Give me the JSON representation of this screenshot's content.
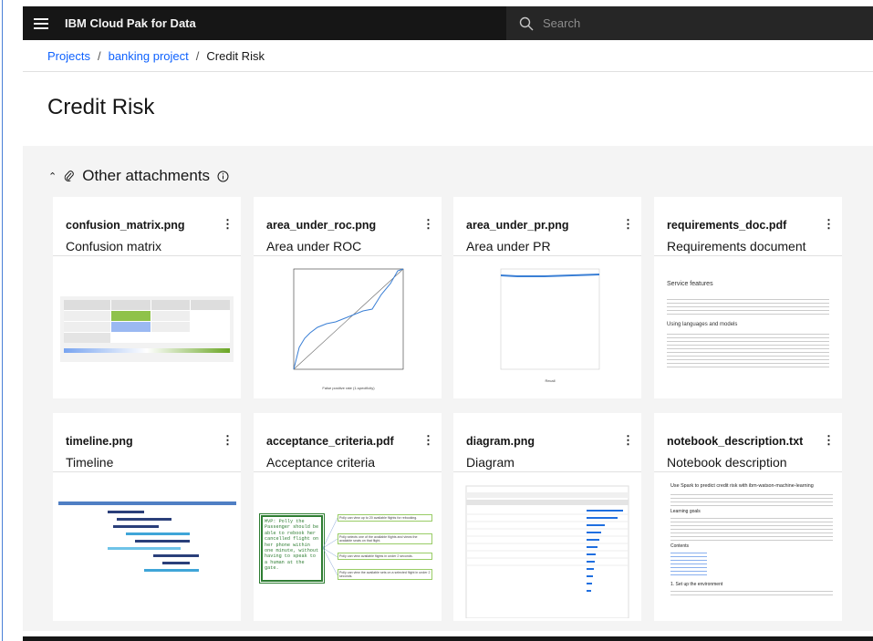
{
  "header": {
    "app_title": "IBM Cloud Pak for Data",
    "search_placeholder": "Search"
  },
  "breadcrumb": [
    {
      "label": "Projects"
    },
    {
      "label": "banking project"
    },
    {
      "label": "Credit Risk"
    }
  ],
  "page_title": "Credit Risk",
  "section": {
    "title": "Other attachments",
    "expanded": true
  },
  "cards": [
    {
      "filename": "confusion_matrix.png",
      "title": "Confusion matrix"
    },
    {
      "filename": "area_under_roc.png",
      "title": "Area under ROC"
    },
    {
      "filename": "area_under_pr.png",
      "title": "Area under PR"
    },
    {
      "filename": "requirements_doc.pdf",
      "title": "Requirements document"
    },
    {
      "filename": "timeline.png",
      "title": "Timeline"
    },
    {
      "filename": "acceptance_criteria.pdf",
      "title": "Acceptance criteria"
    },
    {
      "filename": "diagram.png",
      "title": "Diagram"
    },
    {
      "filename": "notebook_description.txt",
      "title": "Notebook description"
    }
  ],
  "thumbnails": {
    "roc_xlabel": "False positive rate (1-specificity)",
    "pr_xlabel": "Recall",
    "requirements_heading": "Service features",
    "requirements_subheading": "Using languages and models",
    "acceptance_mvp": "MVP: Polly the Passenger should be able to rebook her cancelled flight on her phone within one minute, without having to speak to a human at the gate.",
    "acceptance_items": [
      "Polly can view up to 20 available flights for rebooking.",
      "Polly selects one of the available flights and views the available seats on that flight.",
      "Polly can view available flights in under 2 seconds.",
      "Polly can view the available sets on a selected flight in under 2 seconds."
    ],
    "notebook_heading": "Use Spark to predict credit risk with ibm-watson-machine-learning",
    "notebook_learning": "Learning goals",
    "notebook_contents": "Contents",
    "notebook_setup": "1. Set up the environment"
  }
}
